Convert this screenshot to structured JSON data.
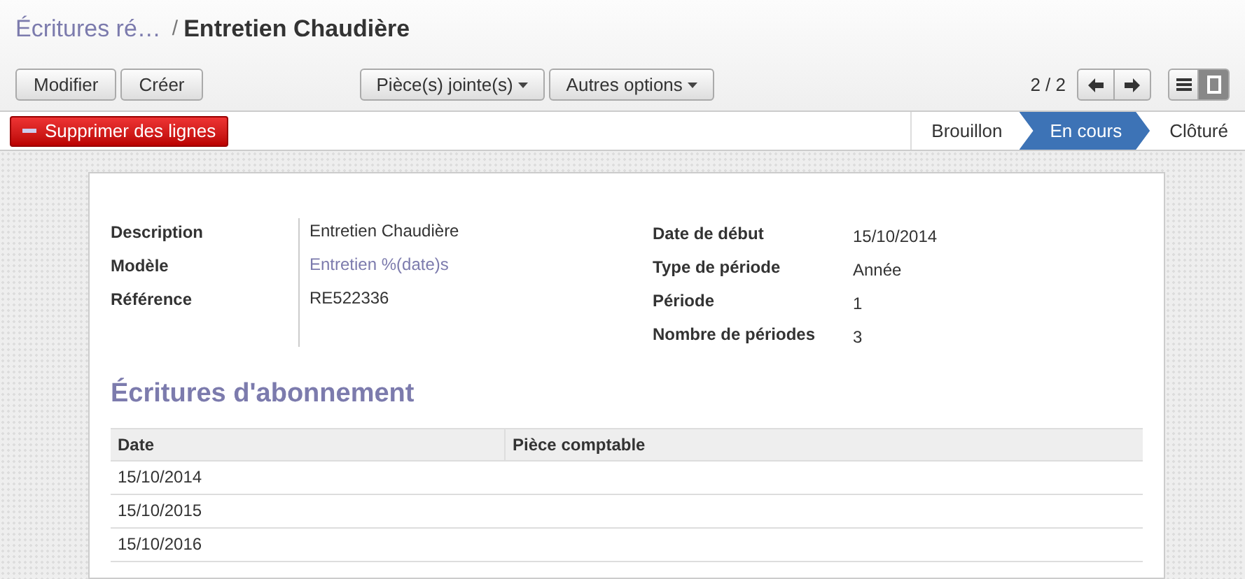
{
  "breadcrumb": {
    "parent": "Écritures ré…",
    "separator": "/",
    "current": "Entretien Chaudière"
  },
  "toolbar": {
    "left_buttons": [
      "Modifier",
      "Créer"
    ],
    "dropdowns": [
      "Pièce(s) jointe(s)",
      "Autres options"
    ],
    "pager": "2 / 2",
    "views": [
      {
        "kind": "list",
        "selected": false
      },
      {
        "kind": "form",
        "selected": true
      }
    ]
  },
  "action_button": "Supprimer des lignes",
  "stages": [
    {
      "label": "Brouillon",
      "selected": false
    },
    {
      "label": "En cours",
      "selected": true
    },
    {
      "label": "Clôturé",
      "selected": false
    }
  ],
  "left_fields": [
    {
      "label": "Description",
      "value": "Entretien Chaudière",
      "kind": "text"
    },
    {
      "label": "Modèle",
      "value": "Entretien %(date)s",
      "kind": "link"
    },
    {
      "label": "Référence",
      "value": "RE522336",
      "kind": "text"
    }
  ],
  "right_fields": [
    {
      "label": "Date de début",
      "value": "15/10/2014"
    },
    {
      "label": "Type de période",
      "value": "Année"
    },
    {
      "label": "Période",
      "value": "1"
    },
    {
      "label": "Nombre de périodes",
      "value": "3"
    }
  ],
  "section_title": "Écritures d'abonnement",
  "table": {
    "columns": [
      "Date",
      "Pièce comptable"
    ],
    "rows": [
      [
        "15/10/2014",
        ""
      ],
      [
        "15/10/2015",
        ""
      ],
      [
        "15/10/2016",
        ""
      ]
    ]
  }
}
